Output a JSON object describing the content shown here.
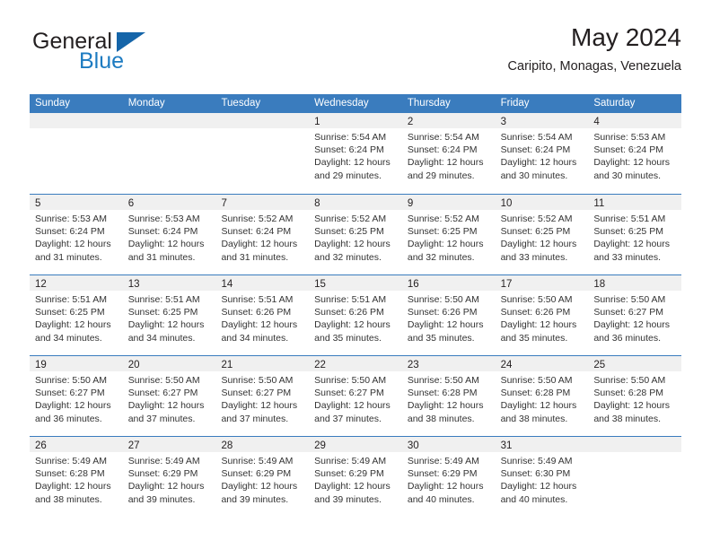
{
  "brand": {
    "name_part1": "General",
    "name_part2": "Blue",
    "logo_icon": "triangle-logo-icon"
  },
  "header": {
    "title": "May 2024",
    "subtitle": "Caripito, Monagas, Venezuela"
  },
  "colors": {
    "header_blue": "#3a7cbe",
    "brand_blue": "#1d7bc1",
    "logo_blue": "#1565a9",
    "day_band_gray": "#f0f0f0",
    "text": "#231f20"
  },
  "weekdays": [
    "Sunday",
    "Monday",
    "Tuesday",
    "Wednesday",
    "Thursday",
    "Friday",
    "Saturday"
  ],
  "weeks": [
    [
      {
        "day": "",
        "lines": []
      },
      {
        "day": "",
        "lines": []
      },
      {
        "day": "",
        "lines": []
      },
      {
        "day": "1",
        "lines": [
          "Sunrise: 5:54 AM",
          "Sunset: 6:24 PM",
          "Daylight: 12 hours",
          "and 29 minutes."
        ]
      },
      {
        "day": "2",
        "lines": [
          "Sunrise: 5:54 AM",
          "Sunset: 6:24 PM",
          "Daylight: 12 hours",
          "and 29 minutes."
        ]
      },
      {
        "day": "3",
        "lines": [
          "Sunrise: 5:54 AM",
          "Sunset: 6:24 PM",
          "Daylight: 12 hours",
          "and 30 minutes."
        ]
      },
      {
        "day": "4",
        "lines": [
          "Sunrise: 5:53 AM",
          "Sunset: 6:24 PM",
          "Daylight: 12 hours",
          "and 30 minutes."
        ]
      }
    ],
    [
      {
        "day": "5",
        "lines": [
          "Sunrise: 5:53 AM",
          "Sunset: 6:24 PM",
          "Daylight: 12 hours",
          "and 31 minutes."
        ]
      },
      {
        "day": "6",
        "lines": [
          "Sunrise: 5:53 AM",
          "Sunset: 6:24 PM",
          "Daylight: 12 hours",
          "and 31 minutes."
        ]
      },
      {
        "day": "7",
        "lines": [
          "Sunrise: 5:52 AM",
          "Sunset: 6:24 PM",
          "Daylight: 12 hours",
          "and 31 minutes."
        ]
      },
      {
        "day": "8",
        "lines": [
          "Sunrise: 5:52 AM",
          "Sunset: 6:25 PM",
          "Daylight: 12 hours",
          "and 32 minutes."
        ]
      },
      {
        "day": "9",
        "lines": [
          "Sunrise: 5:52 AM",
          "Sunset: 6:25 PM",
          "Daylight: 12 hours",
          "and 32 minutes."
        ]
      },
      {
        "day": "10",
        "lines": [
          "Sunrise: 5:52 AM",
          "Sunset: 6:25 PM",
          "Daylight: 12 hours",
          "and 33 minutes."
        ]
      },
      {
        "day": "11",
        "lines": [
          "Sunrise: 5:51 AM",
          "Sunset: 6:25 PM",
          "Daylight: 12 hours",
          "and 33 minutes."
        ]
      }
    ],
    [
      {
        "day": "12",
        "lines": [
          "Sunrise: 5:51 AM",
          "Sunset: 6:25 PM",
          "Daylight: 12 hours",
          "and 34 minutes."
        ]
      },
      {
        "day": "13",
        "lines": [
          "Sunrise: 5:51 AM",
          "Sunset: 6:25 PM",
          "Daylight: 12 hours",
          "and 34 minutes."
        ]
      },
      {
        "day": "14",
        "lines": [
          "Sunrise: 5:51 AM",
          "Sunset: 6:26 PM",
          "Daylight: 12 hours",
          "and 34 minutes."
        ]
      },
      {
        "day": "15",
        "lines": [
          "Sunrise: 5:51 AM",
          "Sunset: 6:26 PM",
          "Daylight: 12 hours",
          "and 35 minutes."
        ]
      },
      {
        "day": "16",
        "lines": [
          "Sunrise: 5:50 AM",
          "Sunset: 6:26 PM",
          "Daylight: 12 hours",
          "and 35 minutes."
        ]
      },
      {
        "day": "17",
        "lines": [
          "Sunrise: 5:50 AM",
          "Sunset: 6:26 PM",
          "Daylight: 12 hours",
          "and 35 minutes."
        ]
      },
      {
        "day": "18",
        "lines": [
          "Sunrise: 5:50 AM",
          "Sunset: 6:27 PM",
          "Daylight: 12 hours",
          "and 36 minutes."
        ]
      }
    ],
    [
      {
        "day": "19",
        "lines": [
          "Sunrise: 5:50 AM",
          "Sunset: 6:27 PM",
          "Daylight: 12 hours",
          "and 36 minutes."
        ]
      },
      {
        "day": "20",
        "lines": [
          "Sunrise: 5:50 AM",
          "Sunset: 6:27 PM",
          "Daylight: 12 hours",
          "and 37 minutes."
        ]
      },
      {
        "day": "21",
        "lines": [
          "Sunrise: 5:50 AM",
          "Sunset: 6:27 PM",
          "Daylight: 12 hours",
          "and 37 minutes."
        ]
      },
      {
        "day": "22",
        "lines": [
          "Sunrise: 5:50 AM",
          "Sunset: 6:27 PM",
          "Daylight: 12 hours",
          "and 37 minutes."
        ]
      },
      {
        "day": "23",
        "lines": [
          "Sunrise: 5:50 AM",
          "Sunset: 6:28 PM",
          "Daylight: 12 hours",
          "and 38 minutes."
        ]
      },
      {
        "day": "24",
        "lines": [
          "Sunrise: 5:50 AM",
          "Sunset: 6:28 PM",
          "Daylight: 12 hours",
          "and 38 minutes."
        ]
      },
      {
        "day": "25",
        "lines": [
          "Sunrise: 5:50 AM",
          "Sunset: 6:28 PM",
          "Daylight: 12 hours",
          "and 38 minutes."
        ]
      }
    ],
    [
      {
        "day": "26",
        "lines": [
          "Sunrise: 5:49 AM",
          "Sunset: 6:28 PM",
          "Daylight: 12 hours",
          "and 38 minutes."
        ]
      },
      {
        "day": "27",
        "lines": [
          "Sunrise: 5:49 AM",
          "Sunset: 6:29 PM",
          "Daylight: 12 hours",
          "and 39 minutes."
        ]
      },
      {
        "day": "28",
        "lines": [
          "Sunrise: 5:49 AM",
          "Sunset: 6:29 PM",
          "Daylight: 12 hours",
          "and 39 minutes."
        ]
      },
      {
        "day": "29",
        "lines": [
          "Sunrise: 5:49 AM",
          "Sunset: 6:29 PM",
          "Daylight: 12 hours",
          "and 39 minutes."
        ]
      },
      {
        "day": "30",
        "lines": [
          "Sunrise: 5:49 AM",
          "Sunset: 6:29 PM",
          "Daylight: 12 hours",
          "and 40 minutes."
        ]
      },
      {
        "day": "31",
        "lines": [
          "Sunrise: 5:49 AM",
          "Sunset: 6:30 PM",
          "Daylight: 12 hours",
          "and 40 minutes."
        ]
      },
      {
        "day": "",
        "lines": []
      }
    ]
  ]
}
